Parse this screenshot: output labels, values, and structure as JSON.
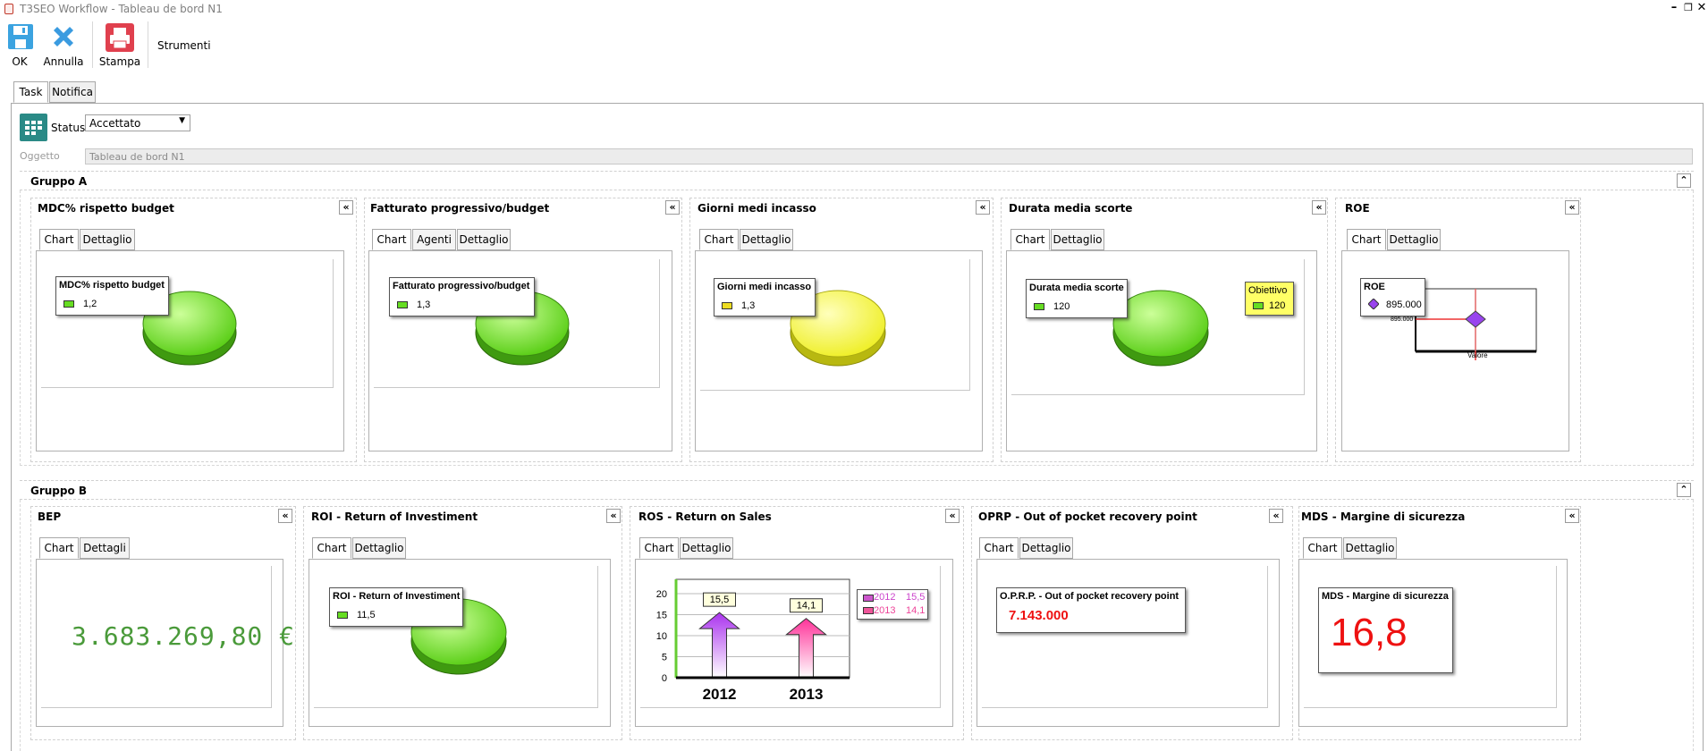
{
  "window": {
    "title": "T3SEO Workflow - Tableau de bord N1"
  },
  "toolbar": {
    "ok_label": "OK",
    "annulla_label": "Annulla",
    "stampa_label": "Stampa",
    "strumenti_label": "Strumenti"
  },
  "tabs": [
    "Task",
    "Notifica"
  ],
  "form": {
    "status_label": "Status",
    "status_value": "Accettato",
    "oggetto_label": "Oggetto",
    "oggetto_value": "Tableau de bord N1"
  },
  "groups": {
    "a_title": "Gruppo A",
    "b_title": "Gruppo B"
  },
  "widgets": {
    "mdc": {
      "title": "MDC% rispetto budget",
      "tabs": [
        "Chart",
        "Dettaglio"
      ],
      "legend_title": "MDC% rispetto budget",
      "value": "1,2",
      "color": "#66dd22"
    },
    "fatt": {
      "title": "Fatturato progressivo/budget",
      "tabs": [
        "Chart",
        "Agenti",
        "Dettaglio"
      ],
      "legend_title": "Fatturato progressivo/budget",
      "value": "1,3",
      "color": "#66dd22"
    },
    "giorni": {
      "title": "Giorni medi incasso",
      "tabs": [
        "Chart",
        "Dettaglio"
      ],
      "legend_title": "Giorni medi incasso",
      "value": "1,3",
      "color": "#eeee22"
    },
    "durata": {
      "title": "Durata media scorte",
      "tabs": [
        "Chart",
        "Dettaglio"
      ],
      "legend_title": "Durata media scorte",
      "value": "120",
      "color": "#66dd22",
      "obiettivo_title": "Obiettivo",
      "obiettivo_value": "120"
    },
    "roe": {
      "title": "ROE",
      "tabs": [
        "Chart",
        "Dettaglio"
      ],
      "legend_title": "ROE",
      "value": "895.000",
      "axis_value": "895.000",
      "xlabel": "Valore",
      "color": "#9944ee"
    },
    "bep": {
      "title": "BEP",
      "tabs": [
        "Chart",
        "Dettagli"
      ],
      "value": "3.683.269,80 €",
      "color": "#4a9a3a"
    },
    "roi": {
      "title": "ROI - Return of Investiment",
      "tabs": [
        "Chart",
        "Dettaglio"
      ],
      "legend_title": "ROI - Return of Investiment",
      "value": "11,5",
      "color": "#66dd22"
    },
    "ros": {
      "title": "ROS - Return on Sales",
      "tabs": [
        "Chart",
        "Dettaglio"
      ]
    },
    "oprp": {
      "title": "OPRP - Out of pocket recovery point",
      "tabs": [
        "Chart",
        "Dettaglio"
      ],
      "legend_title": "O.P.R.P. - Out of pocket recovery point",
      "value": "7.143.000",
      "color": "#ee1111"
    },
    "mds": {
      "title": "MDS - Margine di sicurezza",
      "tabs": [
        "Chart",
        "Dettaglio"
      ],
      "legend_title": "MDS - Margine di sicurezza",
      "value": "16,8",
      "color": "#ee1111"
    }
  },
  "chart_data": {
    "type": "bar",
    "categories": [
      "2012",
      "2013"
    ],
    "values": [
      15.5,
      14.1
    ],
    "data_labels": [
      "15,5",
      "14,1"
    ],
    "ylim": [
      0,
      20
    ],
    "yticks": [
      "0",
      "5",
      "10",
      "15",
      "20"
    ],
    "legend": [
      {
        "name": "2012",
        "value": "15,5",
        "color": "#cc55cc"
      },
      {
        "name": "2013",
        "value": "14,1",
        "color": "#ee5599"
      }
    ],
    "grid": true
  }
}
